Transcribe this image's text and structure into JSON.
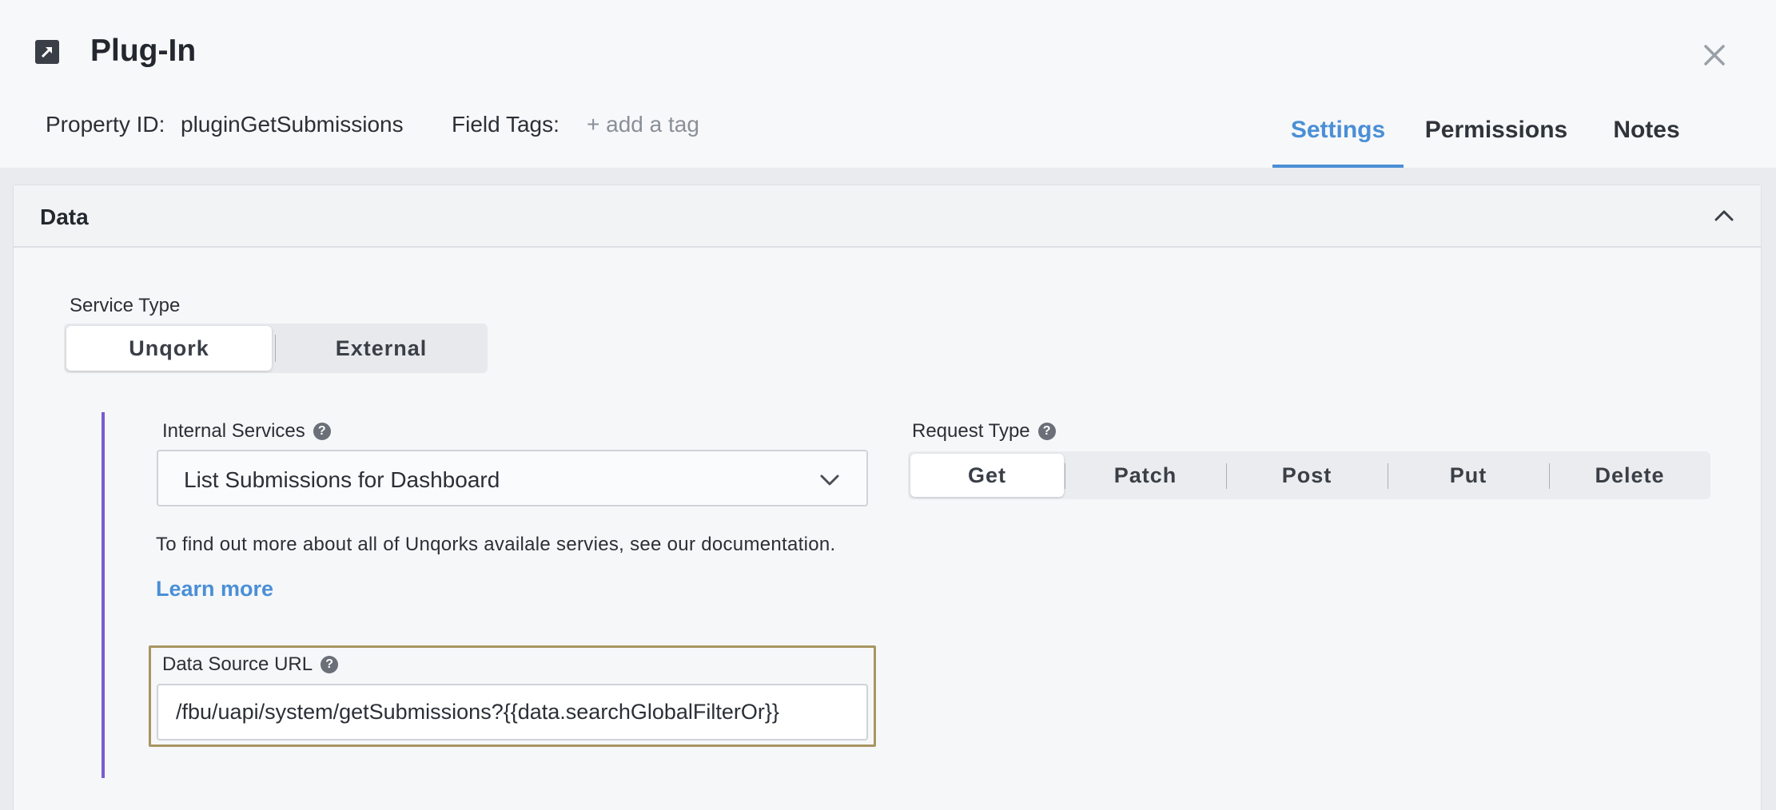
{
  "header": {
    "title": "Plug-In",
    "title_icon": "external-link-icon",
    "close_icon": "close-icon",
    "property_id_label": "Property ID:",
    "property_id_value": "pluginGetSubmissions",
    "field_tags_label": "Field Tags:",
    "add_tag_label": "+ add a tag"
  },
  "tabs": [
    {
      "label": "Settings",
      "active": true
    },
    {
      "label": "Permissions",
      "active": false
    },
    {
      "label": "Notes",
      "active": false
    }
  ],
  "panel": {
    "title": "Data",
    "service_type": {
      "label": "Service Type",
      "options": [
        "Unqork",
        "External"
      ],
      "selected": "Unqork"
    },
    "internal_services": {
      "label": "Internal Services",
      "value": "List Submissions for Dashboard"
    },
    "request_type": {
      "label": "Request Type",
      "options": [
        "Get",
        "Patch",
        "Post",
        "Put",
        "Delete"
      ],
      "selected": "Get"
    },
    "info_text": "To find out more about all of Unqorks availale servies, see our documentation.",
    "learn_more": "Learn more",
    "data_source_url": {
      "label": "Data Source URL",
      "value": "/fbu/uapi/system/getSubmissions?{{data.searchGlobalFilterOr}}"
    }
  },
  "colors": {
    "accent": "#4a8fd6",
    "left_bar": "#7a5bd0",
    "highlight_border": "#a89662"
  }
}
